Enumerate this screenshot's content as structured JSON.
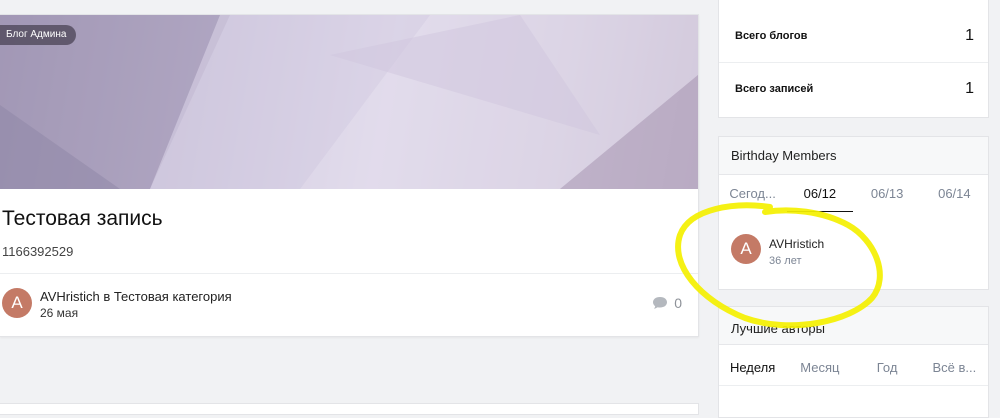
{
  "post": {
    "blog_tag": "Блог Админа",
    "title": "Тестовая запись",
    "excerpt": "1166392529",
    "author_initial": "A",
    "author_line": "AVHristich в Тестовая категория",
    "date": "26 мая",
    "comment_count": "0"
  },
  "stats": {
    "rows": [
      {
        "label": "Всего блогов",
        "value": "1"
      },
      {
        "label": "Всего записей",
        "value": "1"
      }
    ]
  },
  "birthday": {
    "title": "Birthday Members",
    "tabs": [
      "Сегод...",
      "06/12",
      "06/13",
      "06/14"
    ],
    "active_tab": "06/12",
    "member": {
      "initial": "A",
      "name": "AVHristich",
      "age": "36 лет"
    }
  },
  "top_authors": {
    "title": "Лучшие авторы",
    "tabs": [
      "Неделя",
      "Месяц",
      "Год",
      "Всё в..."
    ],
    "active_tab": "Неделя"
  },
  "colors": {
    "avatar": "#c47a66",
    "highlighter": "#f4f000",
    "hero_tint": "#c9c1d9"
  }
}
